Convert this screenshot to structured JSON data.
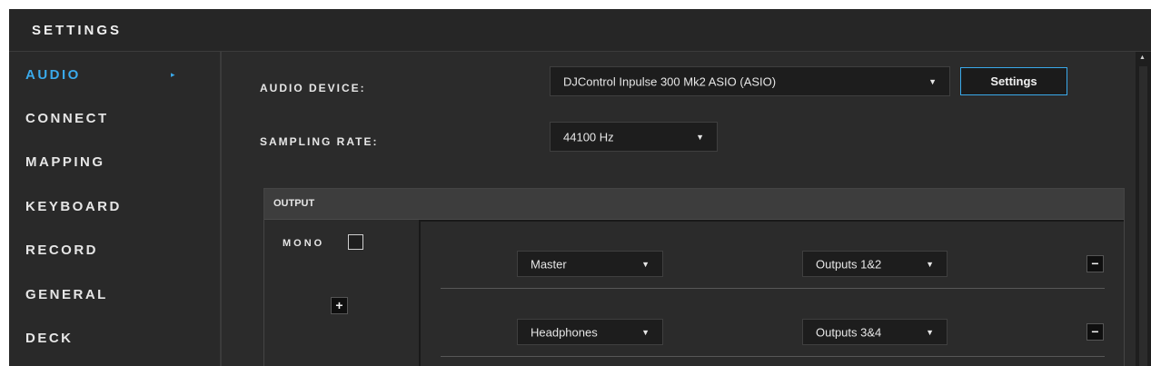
{
  "header": {
    "title": "SETTINGS"
  },
  "sidebar": {
    "items": [
      {
        "label": "AUDIO",
        "active": true
      },
      {
        "label": "CONNECT"
      },
      {
        "label": "MAPPING"
      },
      {
        "label": "KEYBOARD"
      },
      {
        "label": "RECORD"
      },
      {
        "label": "GENERAL"
      },
      {
        "label": "DECK"
      }
    ],
    "active_arrow": "▸"
  },
  "audio": {
    "device_label": "AUDIO DEVICE:",
    "device_value": "DJControl Inpulse 300 Mk2 ASIO (ASIO)",
    "settings_button": "Settings",
    "rate_label": "SAMPLING RATE:",
    "rate_value": "44100 Hz"
  },
  "output": {
    "header": "OUTPUT",
    "mono_label": "MONO",
    "mono_checked": false,
    "add_button": "+",
    "routes": [
      {
        "source": "Master",
        "destination": "Outputs 1&2",
        "remove": "−"
      },
      {
        "source": "Headphones",
        "destination": "Outputs 3&4",
        "remove": "−"
      }
    ]
  },
  "icons": {
    "caret": "▼",
    "scroll_up": "▲"
  },
  "colors": {
    "accent": "#3aa9ea",
    "background": "#2a2a2a"
  }
}
